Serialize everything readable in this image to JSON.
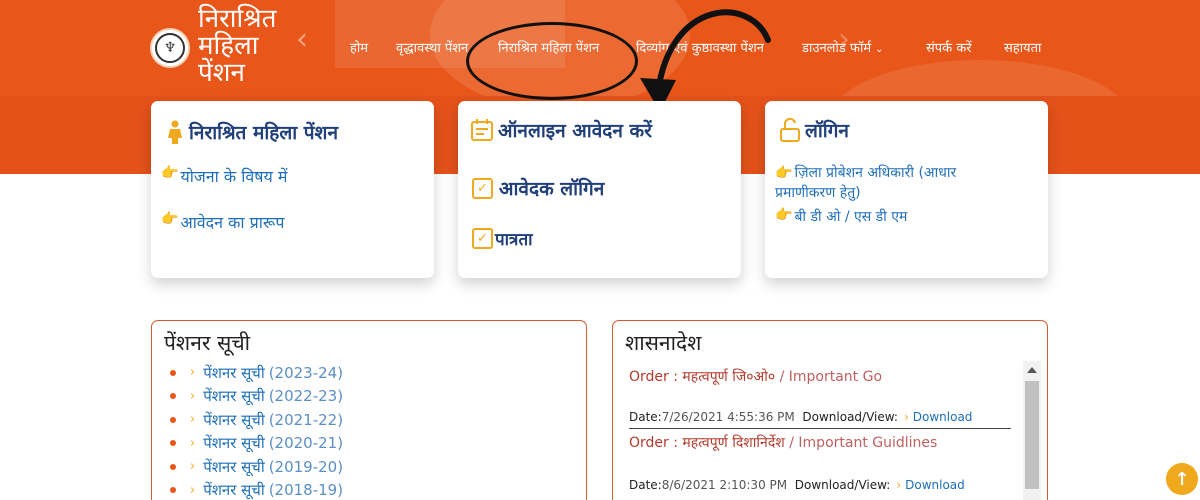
{
  "brand": {
    "title_line1": "निराश्रित",
    "title_line2": "महिला",
    "title_line3": "पेंशन"
  },
  "nav": {
    "items": [
      {
        "label": "होम"
      },
      {
        "label": "वृद्धावस्था पेंशन"
      },
      {
        "label": "निराश्रित महिला पेंशन"
      },
      {
        "label": "दिव्यांग एवं कुष्ठावस्था पेंशन"
      },
      {
        "label": "डाउनलोड फॉर्म"
      },
      {
        "label": "संपर्क करें"
      },
      {
        "label": "सहायता"
      }
    ]
  },
  "cards": {
    "pension": {
      "title": "निराश्रित महिला पेंशन",
      "links": [
        "योजना के विषय में",
        "आवेदन का प्रारूप"
      ]
    },
    "apply": {
      "title": "ऑनलाइन आवेदन करें",
      "links": [
        "आवेदक लॉगिन",
        "पात्रता"
      ]
    },
    "login": {
      "title": "लॉगिन",
      "links": [
        "ज़िला प्रोबेशन अधिकारी (आधार प्रमाणीकरण हेतु)",
        "बी डी ओ / एस डी एम"
      ]
    }
  },
  "pensioner_list": {
    "title": "पेंशनर सूची",
    "items": [
      {
        "label": "पेंशनर सूची",
        "year": "(2023-24)"
      },
      {
        "label": "पेंशनर सूची",
        "year": "(2022-23)"
      },
      {
        "label": "पेंशनर सूची",
        "year": "(2021-22)"
      },
      {
        "label": "पेंशनर सूची",
        "year": "(2020-21)"
      },
      {
        "label": "पेंशनर सूची",
        "year": "(2019-20)"
      },
      {
        "label": "पेंशनर सूची",
        "year": "(2018-19)"
      }
    ]
  },
  "orders": {
    "title": "शासनादेश",
    "items": [
      {
        "prefix": "Order : ",
        "hindi": "महत्वपूर्ण जि०ओ०",
        "english": " / Important Go",
        "date_label": "Date:",
        "date": "7/26/2021 4:55:36 PM",
        "download_label": "Download/View:",
        "download": "Download"
      },
      {
        "prefix": "Order : ",
        "hindi": "महत्वपूर्ण दिशानिर्देश",
        "english": " / Important Guidlines",
        "date_label": "Date:",
        "date": "8/6/2021 2:10:30 PM",
        "download_label": "Download/View:",
        "download": "Download"
      }
    ]
  },
  "colors": {
    "header_orange": "#e8561a",
    "link_blue": "#1f6fb8",
    "title_navy": "#21407a",
    "accent_yellow": "#f0a81c",
    "panel_border": "#d8592a"
  }
}
